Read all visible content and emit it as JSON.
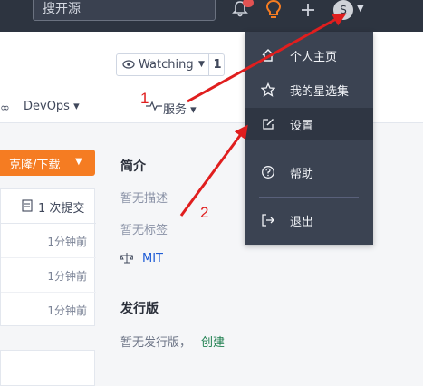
{
  "topbar": {
    "search_placeholder": "搜开源",
    "avatar_letter": "S"
  },
  "repo": {
    "watch_label": "Watching",
    "watch_count": "1"
  },
  "nav": {
    "devops_label": "DevOps",
    "service_label": "服务"
  },
  "clone": {
    "label": "克隆/下载"
  },
  "files": {
    "commit_text": "1 次提交",
    "rows": [
      {
        "time": "1分钟前"
      },
      {
        "time": "1分钟前"
      },
      {
        "time": "1分钟前"
      }
    ]
  },
  "sidebar": {
    "intro_title": "简介",
    "no_desc": "暂无描述",
    "no_tags": "暂无标签",
    "license": "MIT",
    "release_title": "发行版",
    "no_release": "暂无发行版，",
    "create_link": "创建"
  },
  "dropdown": {
    "items": [
      {
        "label": "个人主页",
        "icon": "home-icon"
      },
      {
        "label": "我的星选集",
        "icon": "star-icon"
      },
      {
        "label": "设置",
        "icon": "edit-icon"
      },
      {
        "label": "帮助",
        "icon": "help-icon"
      },
      {
        "label": "退出",
        "icon": "logout-icon"
      }
    ]
  },
  "annotations": {
    "label_1": "1",
    "label_2": "2",
    "color": "#e01e1e"
  },
  "colors": {
    "topbar": "#2d3440",
    "accent_orange": "#f57c22",
    "dropdown_bg": "#3b4352"
  }
}
